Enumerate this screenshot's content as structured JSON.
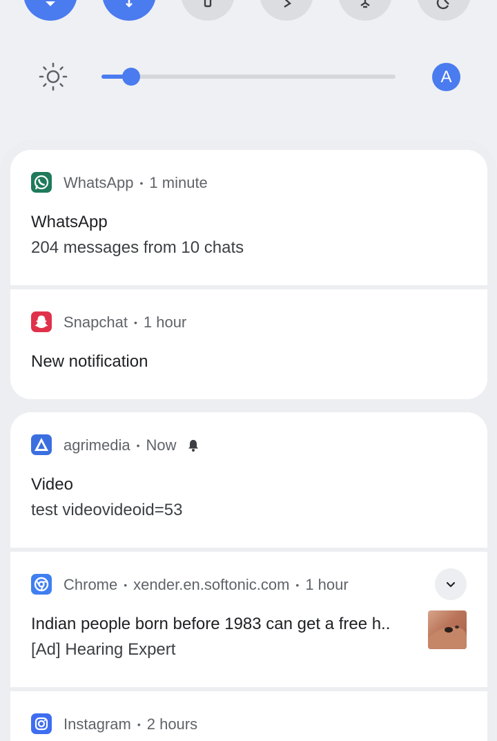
{
  "quick_settings": {
    "tiles": [
      {
        "name": "wifi-tile",
        "state": "on",
        "icon": "wifi-icon"
      },
      {
        "name": "bluetooth-tile",
        "state": "on",
        "icon": "bluetooth-icon"
      },
      {
        "name": "flashlight-tile",
        "state": "off",
        "icon": "flashlight-icon"
      },
      {
        "name": "cast-tile",
        "state": "off",
        "icon": "cast-icon"
      },
      {
        "name": "airplane-tile",
        "state": "off",
        "icon": "airplane-icon"
      },
      {
        "name": "autorotate-tile",
        "state": "off",
        "icon": "autorotate-icon"
      }
    ]
  },
  "brightness": {
    "icon": "sun-icon",
    "level": 0.1,
    "avatar_letter": "A"
  },
  "notifications": {
    "whatsapp": {
      "app": "WhatsApp",
      "time": "1 minute",
      "title": "WhatsApp",
      "body": "204 messages from 10 chats",
      "icon": "whatsapp-icon"
    },
    "snapchat": {
      "app": "Snapchat",
      "time": "1 hour",
      "title": "New notification",
      "icon": "snapchat-icon"
    },
    "agrimedia": {
      "app": "agrimedia",
      "time": "Now",
      "title": "Video",
      "body": "test videovideoid=53",
      "icon": "agrimedia-icon"
    },
    "chrome": {
      "app": "Chrome",
      "site": "xender.en.softonic.com",
      "time": "1 hour",
      "title": "Indian people born before 1983 can get a free h..",
      "body": "[Ad] Hearing Expert",
      "icon": "chrome-icon"
    },
    "instagram": {
      "app": "Instagram",
      "time": "2 hours",
      "icon": "instagram-icon"
    }
  },
  "colors": {
    "accent": "#4a7bef",
    "whatsapp": "#1f7a5c",
    "snapchat": "#e0314a",
    "agrimedia": "#3b6fe0",
    "chrome": "#3f7ff0",
    "instagram": "#3f6df0"
  }
}
